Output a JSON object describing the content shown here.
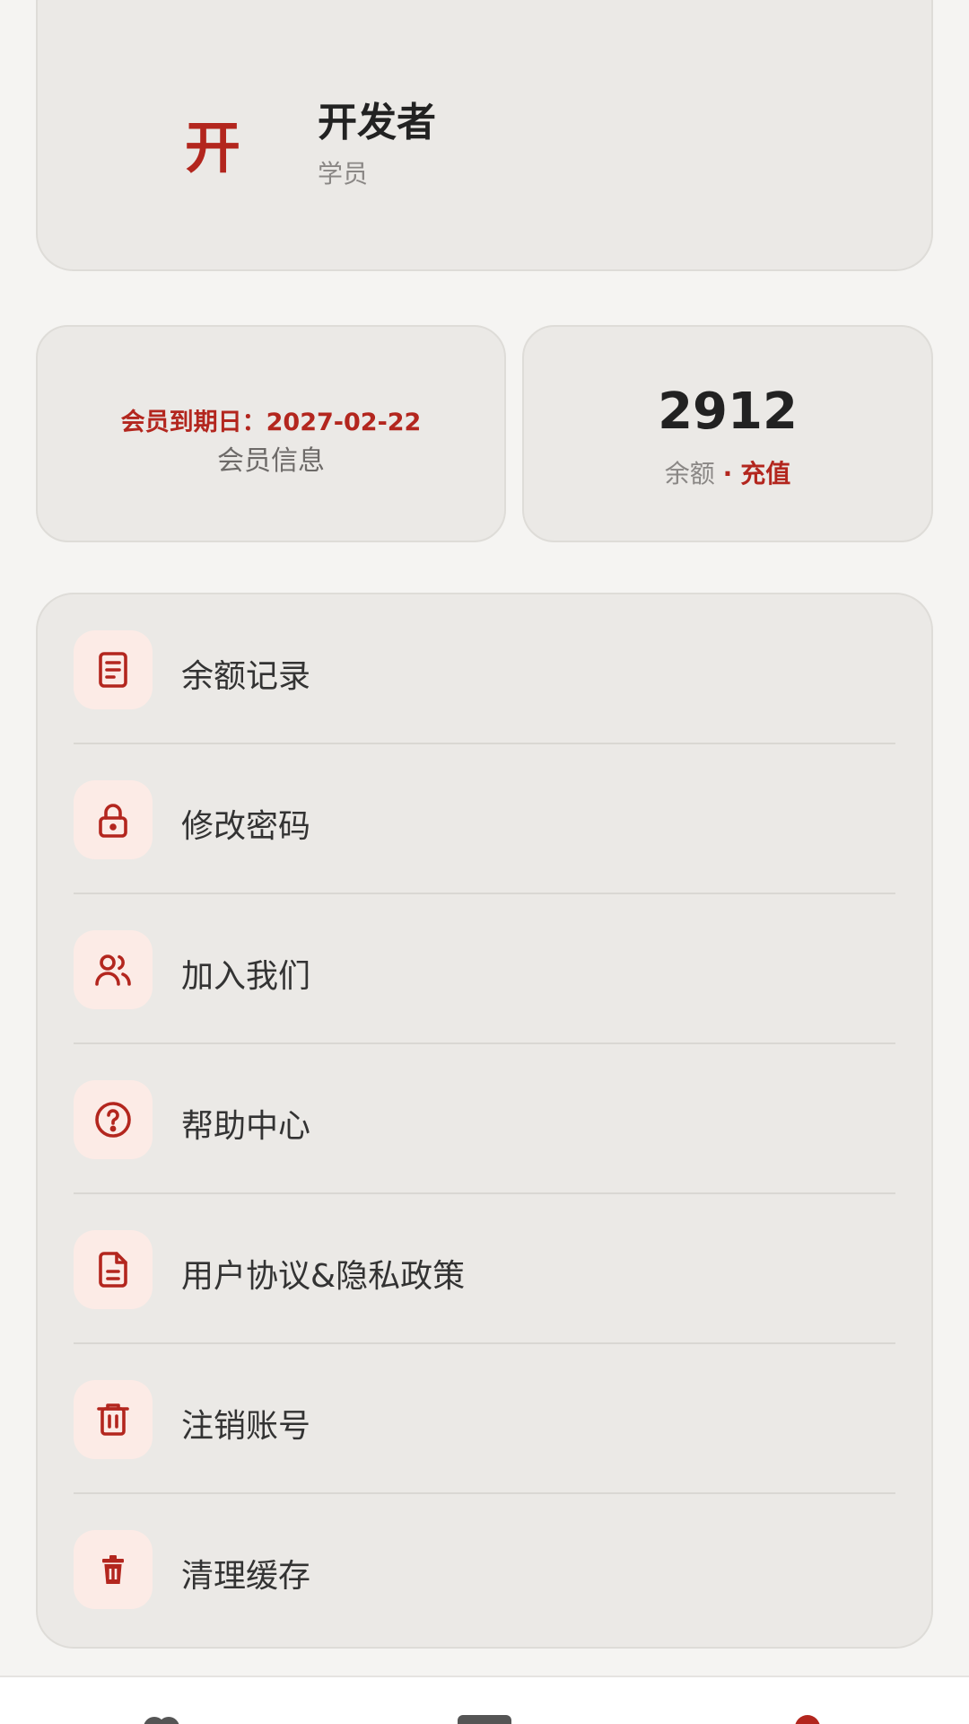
{
  "profile": {
    "avatar_char": "开",
    "name": "开发者",
    "role": "学员"
  },
  "membership": {
    "expiry_text": "会员到期日：2027-02-22",
    "label": "会员信息"
  },
  "balance": {
    "value": "2912",
    "label": "余额",
    "separator": "·",
    "recharge_label": "充值"
  },
  "menu": {
    "items": [
      {
        "label": "余额记录",
        "icon": "document-list-icon"
      },
      {
        "label": "修改密码",
        "icon": "lock-icon"
      },
      {
        "label": "加入我们",
        "icon": "users-icon"
      },
      {
        "label": "帮助中心",
        "icon": "help-circle-icon"
      },
      {
        "label": "用户协议&隐私政策",
        "icon": "file-text-icon"
      },
      {
        "label": "注销账号",
        "icon": "trash-icon"
      },
      {
        "label": "清理缓存",
        "icon": "trash-filled-icon"
      }
    ]
  },
  "bottom_nav": {
    "items": [
      {
        "icon": "home-icon"
      },
      {
        "icon": "course-icon"
      },
      {
        "icon": "profile-icon",
        "active": true
      }
    ]
  },
  "colors": {
    "accent": "#b3261e",
    "icon_bg": "#fcebe6",
    "card_bg": "#ebe9e6",
    "page_bg": "#f5f4f2"
  }
}
